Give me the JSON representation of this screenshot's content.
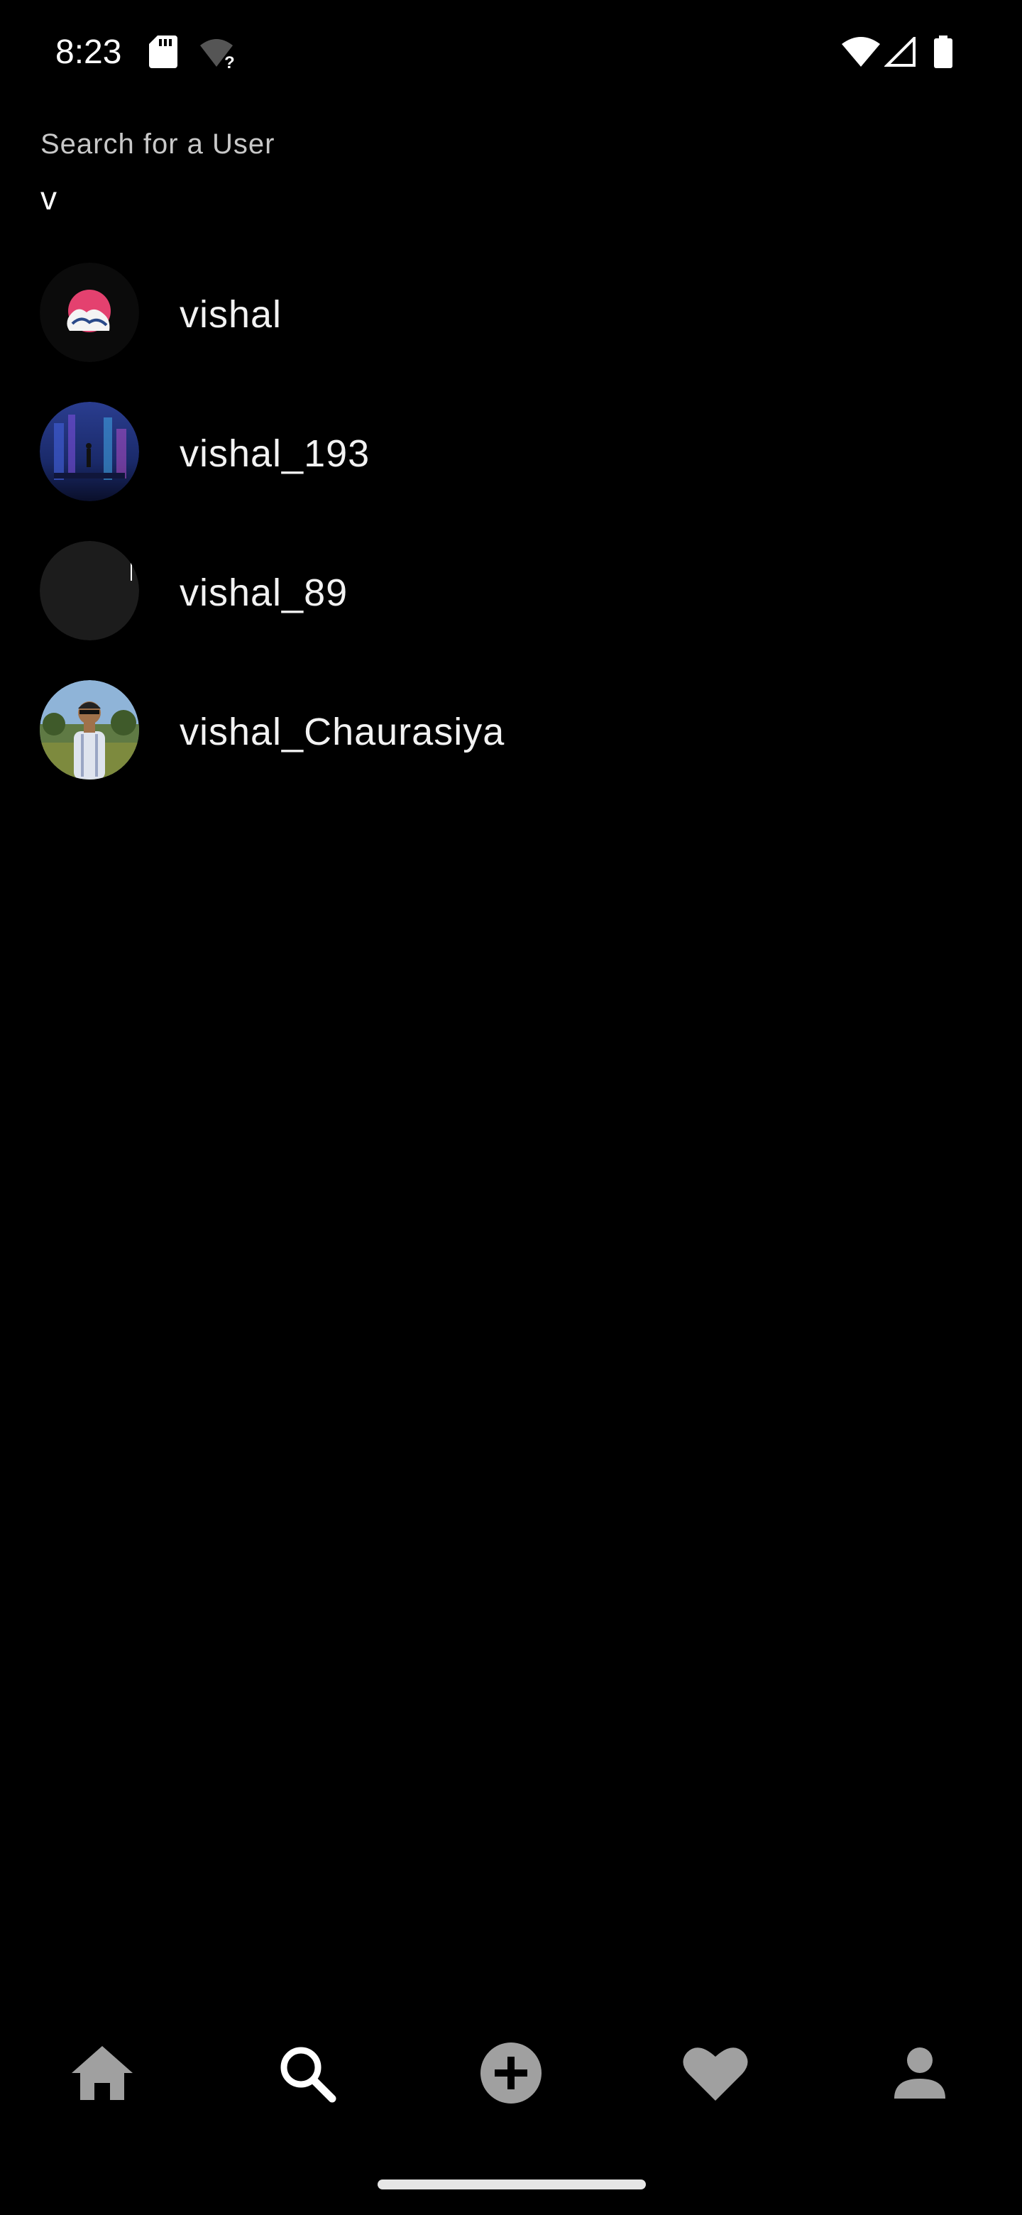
{
  "status_bar": {
    "time": "8:23",
    "icons": [
      "sd-card-icon",
      "wifi-question-icon",
      "wifi-icon",
      "signal-icon",
      "battery-icon"
    ]
  },
  "search": {
    "label": "Search for a User",
    "value": "v"
  },
  "results": [
    {
      "username": "vishal",
      "avatar": "wave-art-avatar"
    },
    {
      "username": "vishal_193",
      "avatar": "cyberpunk-city-avatar"
    },
    {
      "username": "vishal_89",
      "avatar": "blank-avatar"
    },
    {
      "username": "vishal_Chaurasiya",
      "avatar": "photo-person-avatar"
    }
  ],
  "bottom_nav": {
    "items": [
      "home-icon",
      "search-icon",
      "add-circle-icon",
      "heart-icon",
      "profile-icon"
    ],
    "active": "search-icon"
  },
  "colors": {
    "background": "#000000",
    "text": "#f2f2f2",
    "label": "#c8c8c8",
    "nav_inactive": "#a0a0a0",
    "nav_active": "#ffffff"
  }
}
